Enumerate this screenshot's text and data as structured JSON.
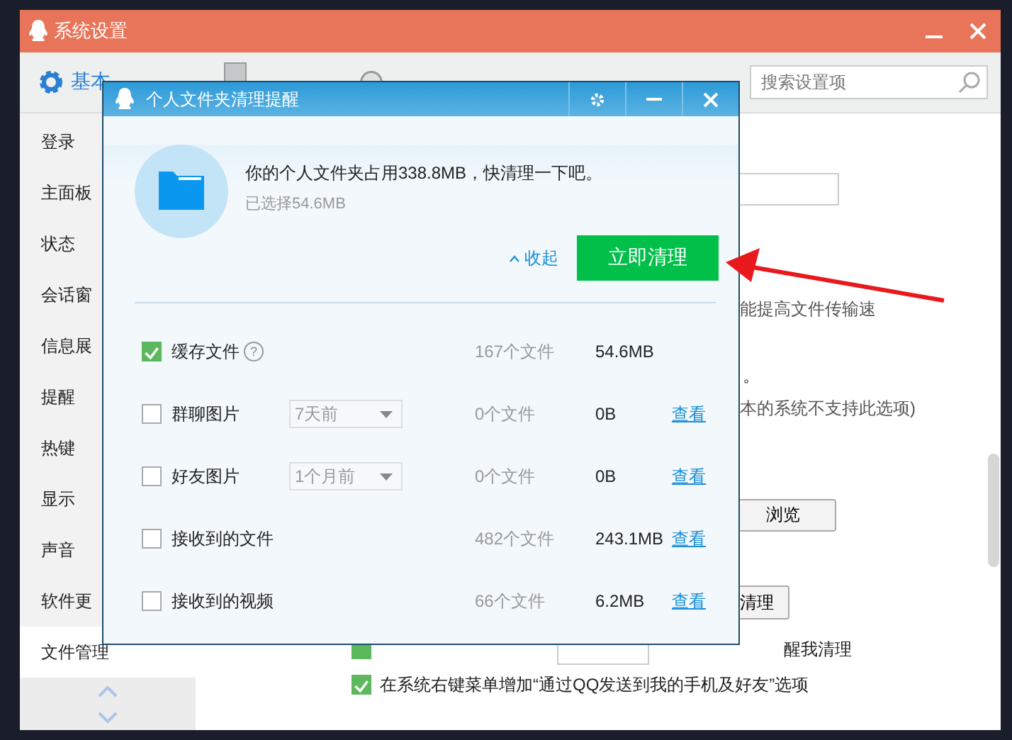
{
  "window": {
    "title": "系统设置"
  },
  "tabs": [
    {
      "label": "基本",
      "selected": true
    },
    {
      "selected": false
    },
    {
      "selected": false
    }
  ],
  "search": {
    "placeholder": "搜索设置项"
  },
  "sidebar": {
    "items": [
      {
        "label": "登录",
        "selected": false
      },
      {
        "label": "主面板",
        "selected": false
      },
      {
        "label": "状态",
        "selected": false
      },
      {
        "label": "会话窗",
        "selected": false
      },
      {
        "label": "信息展",
        "selected": false
      },
      {
        "label": "提醒",
        "selected": false
      },
      {
        "label": "热键",
        "selected": false
      },
      {
        "label": "显示",
        "selected": false
      },
      {
        "label": "声音",
        "selected": false
      },
      {
        "label": "软件更",
        "selected": false
      },
      {
        "label": "文件管理",
        "selected": true
      }
    ]
  },
  "content": {
    "rows": [
      {
        "kind": "field"
      },
      {
        "kind": "note",
        "text": "能提高文件传输速"
      },
      {
        "kind": "note",
        "text": "。"
      },
      {
        "kind": "note",
        "text": "本的系统不支持此选项)"
      },
      {
        "kind": "button",
        "text": "浏览"
      },
      {
        "kind": "button",
        "text": "清理"
      },
      {
        "kind": "check_select",
        "checked": true,
        "text": "醒我清理"
      },
      {
        "kind": "check",
        "checked": true,
        "text": "在系统右键菜单增加“通过QQ发送到我的手机及好友”选项"
      }
    ]
  },
  "dialog": {
    "title": "个人文件夹清理提醒",
    "message": "你的个人文件夹占用338.8MB，快清理一下吧。",
    "selected_size": "已选择54.6MB",
    "collapse_link": "收起",
    "clean_button": "立即清理",
    "items": [
      {
        "label": "缓存文件",
        "checked": true,
        "help": "?",
        "count": "167个文件",
        "size": "54.6MB"
      },
      {
        "label": "群聊图片",
        "checked": false,
        "period": "7天前",
        "count": "0个文件",
        "size": "0B",
        "view": "查看"
      },
      {
        "label": "好友图片",
        "checked": false,
        "period": "1个月前",
        "count": "0个文件",
        "size": "0B",
        "view": "查看"
      },
      {
        "label": "接收到的文件",
        "checked": false,
        "count": "482个文件",
        "size": "243.1MB",
        "view": "查看"
      },
      {
        "label": "接收到的视频",
        "checked": false,
        "count": "66个文件",
        "size": "6.2MB",
        "view": "查看"
      }
    ]
  }
}
